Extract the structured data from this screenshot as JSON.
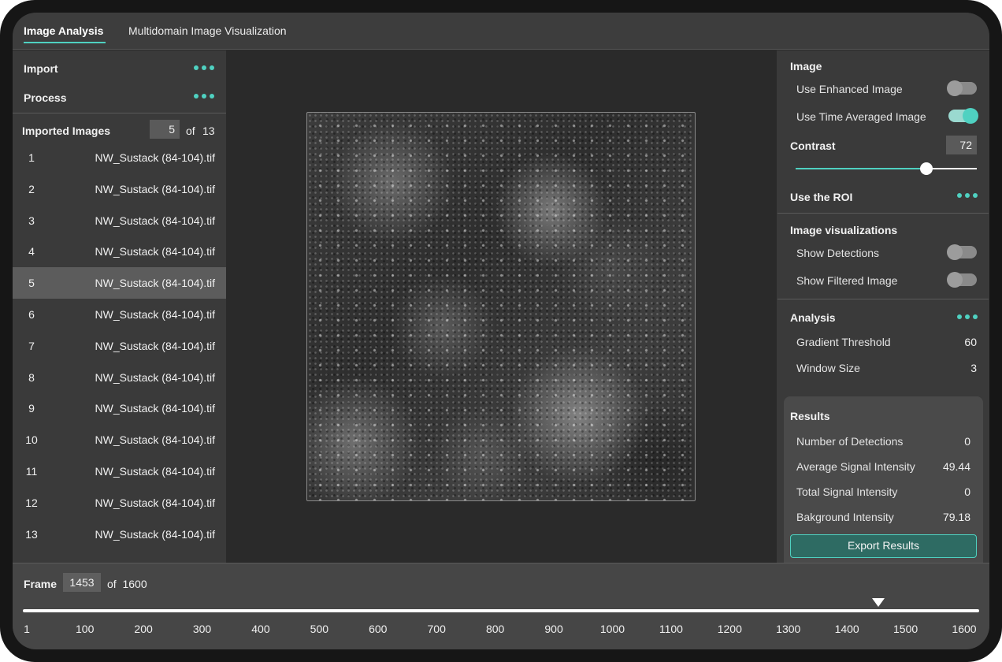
{
  "tabs": [
    {
      "label": "Image Analysis",
      "active": true
    },
    {
      "label": "Multidomain Image Visualization",
      "active": false
    }
  ],
  "left_panel": {
    "import_label": "Import",
    "process_label": "Process",
    "imported_images_label": "Imported Images",
    "current_index": "5",
    "of_label": "of",
    "total": "13",
    "selected": 5,
    "images": [
      {
        "num": "1",
        "name": "NW_Sustack (84-104).tif"
      },
      {
        "num": "2",
        "name": "NW_Sustack (84-104).tif"
      },
      {
        "num": "3",
        "name": "NW_Sustack (84-104).tif"
      },
      {
        "num": "4",
        "name": "NW_Sustack (84-104).tif"
      },
      {
        "num": "5",
        "name": "NW_Sustack (84-104).tif"
      },
      {
        "num": "6",
        "name": "NW_Sustack (84-104).tif"
      },
      {
        "num": "7",
        "name": "NW_Sustack (84-104).tif"
      },
      {
        "num": "8",
        "name": "NW_Sustack (84-104).tif"
      },
      {
        "num": "9",
        "name": "NW_Sustack (84-104).tif"
      },
      {
        "num": "10",
        "name": "NW_Sustack (84-104).tif"
      },
      {
        "num": "11",
        "name": "NW_Sustack (84-104).tif"
      },
      {
        "num": "12",
        "name": "NW_Sustack (84-104).tif"
      },
      {
        "num": "13",
        "name": "NW_Sustack (84-104).tif"
      }
    ]
  },
  "right_panel": {
    "image_title": "Image",
    "use_enhanced_label": "Use Enhanced Image",
    "use_enhanced_on": false,
    "use_time_avg_label": "Use Time Averaged Image",
    "use_time_avg_on": true,
    "contrast_label": "Contrast",
    "contrast_value": "72",
    "roi_label": "Use the ROI",
    "visualizations_title": "Image visualizations",
    "show_detections_label": "Show Detections",
    "show_detections_on": false,
    "show_filtered_label": "Show Filtered Image",
    "show_filtered_on": false,
    "analysis_title": "Analysis",
    "gradient_threshold_label": "Gradient Threshold",
    "gradient_threshold_value": "60",
    "window_size_label": "Window Size",
    "window_size_value": "3",
    "results_title": "Results",
    "results": [
      {
        "label": "Number of Detections",
        "value": "0"
      },
      {
        "label": "Average Signal Intensity",
        "value": "49.44"
      },
      {
        "label": "Total Signal Intensity",
        "value": "0"
      },
      {
        "label": "Bakground Intensity",
        "value": "79.18"
      }
    ],
    "export_label": "Export Results"
  },
  "timeline": {
    "frame_label": "Frame",
    "frame_value": "1453",
    "of_label": "of",
    "total_frames": "1600",
    "ticks": [
      "1",
      "100",
      "200",
      "300",
      "400",
      "500",
      "600",
      "700",
      "800",
      "900",
      "1000",
      "1100",
      "1200",
      "1300",
      "1400",
      "1500",
      "1600"
    ]
  },
  "colors": {
    "accent": "#4fd1c1",
    "button_fill": "#2e6b63"
  }
}
